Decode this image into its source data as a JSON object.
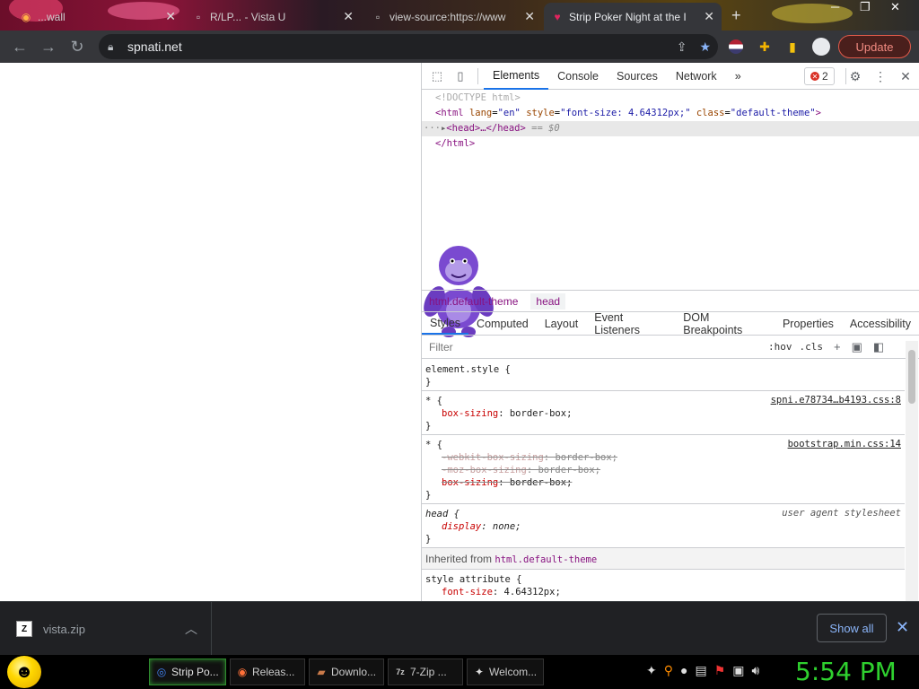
{
  "browser": {
    "tabs": [
      {
        "title": "...wall",
        "icon": "firefox-icon",
        "active": false
      },
      {
        "title": "R/LP... - Vista U",
        "icon": "page-icon",
        "active": false
      },
      {
        "title": "view-source:https://www",
        "icon": "page-icon",
        "active": false
      },
      {
        "title": "Strip Poker Night at the I",
        "icon": "heart-icon",
        "active": true
      }
    ],
    "url": "spnati.net",
    "update_label": "Update"
  },
  "devtools": {
    "tabs": [
      "Elements",
      "Console",
      "Sources",
      "Network"
    ],
    "more": "»",
    "error_count": "2",
    "dom": {
      "doctype": "<!DOCTYPE html>",
      "html_open_tag": "<html",
      "html_attr1": "lang",
      "html_val1": "\"en\"",
      "html_attr2": "style",
      "html_val2": "\"font-size: 4.64312px;\"",
      "html_attr3": "class",
      "html_val3": "\"default-theme\"",
      "head_line": "<head>…</head>",
      "head_eq": "== $0",
      "html_close": "</html>"
    },
    "breadcrumbs": {
      "html": "html.default-theme",
      "head": "head"
    },
    "subtabs": [
      "Styles",
      "Computed",
      "Layout",
      "Event Listeners",
      "DOM Breakpoints",
      "Properties",
      "Accessibility"
    ],
    "filter_placeholder": "Filter",
    "hov": ":hov",
    "cls": ".cls",
    "styles": {
      "element_style": "element.style {",
      "close": "}",
      "rule1_selector": "* {",
      "rule1_source": "spni.e78734…b4193.css:8",
      "rule1_prop": "box-sizing",
      "rule1_val": ": border-box;",
      "rule2_selector": "* {",
      "rule2_source": "bootstrap.min.css:14",
      "rule2_p1": "-webkit-box-sizing",
      "rule2_v1": ": border-box;",
      "rule2_p2": "-moz-box-sizing",
      "rule2_v2": ": border-box;",
      "rule2_p3": "box-sizing",
      "rule2_v3": ": border-box;",
      "rule3_selector": "head {",
      "rule3_source": "user agent stylesheet",
      "rule3_prop": "display",
      "rule3_val": ": none;",
      "inherited_label": "Inherited from",
      "inherited_tag": "html.default-theme",
      "style_attr": "style attribute {",
      "style_attr_prop": "font-size",
      "style_attr_val": ": 4.64312px;"
    }
  },
  "downloads": {
    "file": "vista.zip",
    "show_all": "Show all"
  },
  "taskbar": {
    "items": [
      "Strip Po...",
      "Releas...",
      "Downlo...",
      "7-Zip ...",
      "Welcom..."
    ],
    "clock": "5:54 PM"
  }
}
